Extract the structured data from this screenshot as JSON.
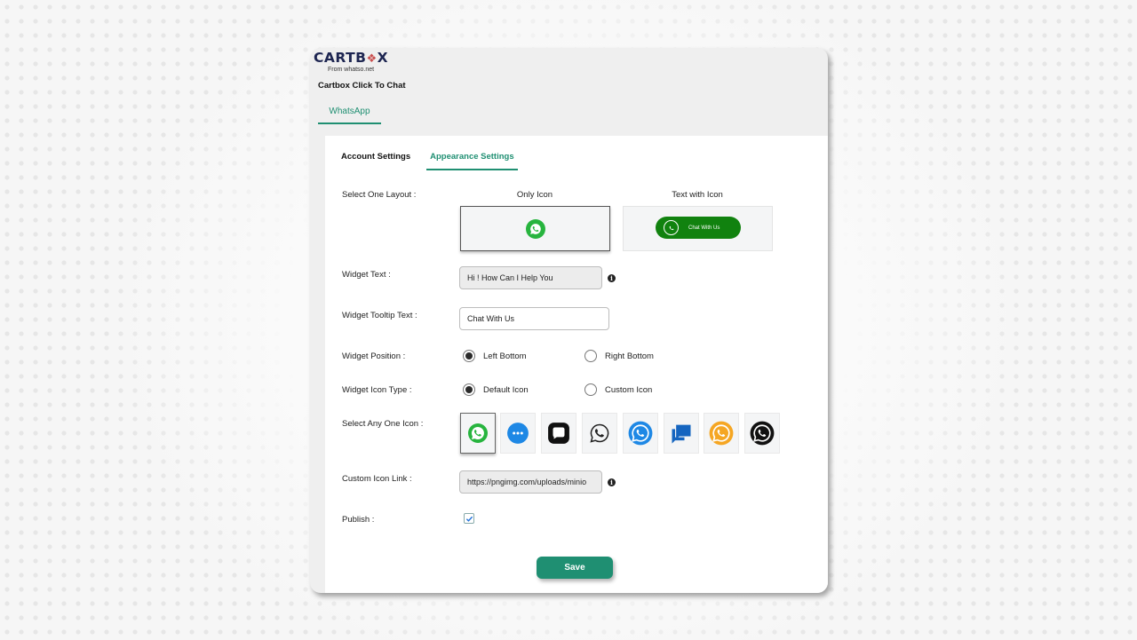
{
  "brand": {
    "logo_text_prefix": "CARTB",
    "logo_text_suffix": "X",
    "logo_sub": "From whatso.net"
  },
  "app_title": "Cartbox Click To Chat",
  "top_tab": "WhatsApp",
  "tabs": [
    {
      "label": "Account Settings",
      "active": false
    },
    {
      "label": "Appearance Settings",
      "active": true
    }
  ],
  "layout": {
    "label": "Select One Layout :",
    "options": [
      {
        "title": "Only Icon",
        "selected": true
      },
      {
        "title": "Text with Icon",
        "selected": false,
        "button_text": "Chat With Us"
      }
    ]
  },
  "widget_text": {
    "label": "Widget Text :",
    "value": "Hi ! How Can I Help You"
  },
  "widget_tooltip": {
    "label": "Widget Tooltip Text :",
    "value": "Chat With Us"
  },
  "widget_position": {
    "label": "Widget Position :",
    "options": [
      {
        "label": "Left Bottom",
        "checked": true
      },
      {
        "label": "Right Bottom",
        "checked": false
      }
    ]
  },
  "widget_icon_type": {
    "label": "Widget Icon Type :",
    "options": [
      {
        "label": "Default Icon",
        "checked": true
      },
      {
        "label": "Custom Icon",
        "checked": false
      }
    ]
  },
  "icon_select": {
    "label": "Select Any One Icon :",
    "icons": [
      "whatsapp-green-icon",
      "messenger-blue-icon",
      "chat-bubble-black-icon",
      "whatsapp-outline-icon",
      "whatsapp-blue-icon",
      "chat-bubbles-blue-icon",
      "whatsapp-orange-icon",
      "whatsapp-black-icon"
    ],
    "selected_index": 0
  },
  "custom_icon_link": {
    "label": "Custom Icon Link :",
    "value": "https://pngimg.com/uploads/minio"
  },
  "publish": {
    "label": "Publish :",
    "checked": true
  },
  "save_label": "Save",
  "colors": {
    "accent": "#1f8f72",
    "whatsapp_green": "#27b43e",
    "pill_green": "#11820f",
    "logo_navy": "#1d2551"
  }
}
